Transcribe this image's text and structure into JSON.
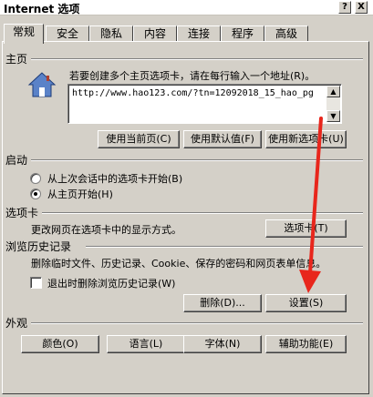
{
  "window": {
    "title": "Internet 选项",
    "help_btn": "?",
    "close_btn": "X"
  },
  "tabs": [
    "常规",
    "安全",
    "隐私",
    "内容",
    "连接",
    "程序",
    "高级"
  ],
  "home": {
    "section": "主页",
    "instruction": "若要创建多个主页选项卡，请在每行输入一个地址(R)。",
    "url": "http://www.hao123.com/?tn=12092018_15_hao_pg",
    "buttons": [
      "使用当前页(C)",
      "使用默认值(F)",
      "使用新选项卡(U)"
    ],
    "icon": "home-icon"
  },
  "startup": {
    "section": "启动",
    "options": [
      "从上次会话中的选项卡开始(B)",
      "从主页开始(H)"
    ],
    "selected_index": 1
  },
  "tabs_section": {
    "section": "选项卡",
    "description": "更改网页在选项卡中的显示方式。",
    "button": "选项卡(T)"
  },
  "history": {
    "section": "浏览历史记录",
    "description": "删除临时文件、历史记录、Cookie、保存的密码和网页表单信息。",
    "checkbox": "退出时删除浏览历史记录(W)",
    "checkbox_checked": false,
    "delete_button": "删除(D)...",
    "settings_button": "设置(S)"
  },
  "appearance": {
    "section": "外观",
    "buttons": [
      "颜色(O)",
      "语言(L)",
      "字体(N)",
      "辅助功能(E)"
    ]
  },
  "annotation_color": "#e8261c"
}
